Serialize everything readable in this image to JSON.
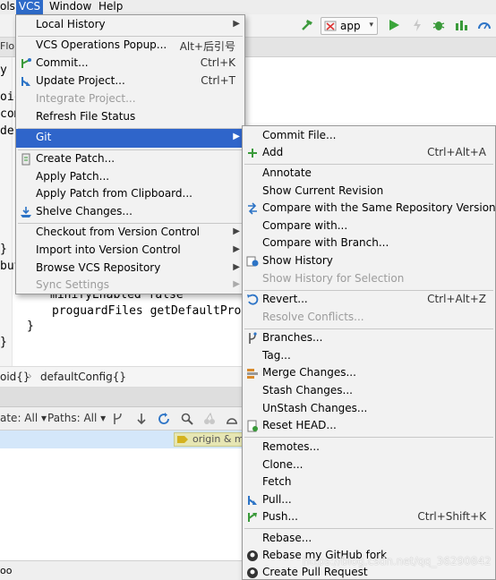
{
  "menubar": {
    "tools": "ols",
    "vcs": "VCS",
    "window": "Window",
    "help": "Help"
  },
  "toolbar": {
    "run_config": "app"
  },
  "tab_strip": {
    "visible_text": "Flo"
  },
  "editor": {
    "gutter_fragments": [
      "y",
      "oic",
      "com",
      "def",
      "}",
      "but",
      "}"
    ],
    "line_minify": "minifyEnabled false",
    "line_proguard": "proguardFiles getDefaultProg",
    "line_brace_1": "}",
    "line_brace_2": "}"
  },
  "breadcrumb": {
    "item1": "oid{}",
    "separator": "›",
    "item2": "defaultConfig{}"
  },
  "panel_toolbar": {
    "date_filter": "ate: All ▾",
    "paths_filter": "Paths: All ▾"
  },
  "log": {
    "origin_tag": "origin & m"
  },
  "statusbar": {
    "text": "oo"
  },
  "vcs_menu": {
    "items": [
      {
        "label": "Local History",
        "shortcut": "",
        "submenu": true,
        "disabled": false,
        "highlighted": false
      },
      {
        "label": "VCS Operations Popup...",
        "shortcut": "Alt+后引号",
        "submenu": false,
        "disabled": false,
        "highlighted": false
      },
      {
        "label": "Commit...",
        "shortcut": "Ctrl+K",
        "submenu": false,
        "disabled": false,
        "highlighted": false
      },
      {
        "label": "Update Project...",
        "shortcut": "Ctrl+T",
        "submenu": false,
        "disabled": false,
        "highlighted": false
      },
      {
        "label": "Integrate Project...",
        "shortcut": "",
        "submenu": false,
        "disabled": true,
        "highlighted": false
      },
      {
        "label": "Refresh File Status",
        "shortcut": "",
        "submenu": false,
        "disabled": false,
        "highlighted": false
      },
      {
        "label": "Git",
        "shortcut": "",
        "submenu": true,
        "disabled": false,
        "highlighted": true
      },
      {
        "label": "Create Patch...",
        "shortcut": "",
        "submenu": false,
        "disabled": false,
        "highlighted": false
      },
      {
        "label": "Apply Patch...",
        "shortcut": "",
        "submenu": false,
        "disabled": false,
        "highlighted": false
      },
      {
        "label": "Apply Patch from Clipboard...",
        "shortcut": "",
        "submenu": false,
        "disabled": false,
        "highlighted": false
      },
      {
        "label": "Shelve Changes...",
        "shortcut": "",
        "submenu": false,
        "disabled": false,
        "highlighted": false
      },
      {
        "label": "Checkout from Version Control",
        "shortcut": "",
        "submenu": true,
        "disabled": false,
        "highlighted": false
      },
      {
        "label": "Import into Version Control",
        "shortcut": "",
        "submenu": true,
        "disabled": false,
        "highlighted": false
      },
      {
        "label": "Browse VCS Repository",
        "shortcut": "",
        "submenu": true,
        "disabled": false,
        "highlighted": false
      },
      {
        "label": "Sync Settings",
        "shortcut": "",
        "submenu": true,
        "disabled": true,
        "highlighted": false
      }
    ]
  },
  "git_menu": {
    "items": [
      {
        "label": "Commit File...",
        "shortcut": "",
        "disabled": false
      },
      {
        "label": "Add",
        "shortcut": "Ctrl+Alt+A",
        "disabled": false
      },
      {
        "label": "Annotate",
        "shortcut": "",
        "disabled": false
      },
      {
        "label": "Show Current Revision",
        "shortcut": "",
        "disabled": false
      },
      {
        "label": "Compare with the Same Repository Version",
        "shortcut": "",
        "disabled": false
      },
      {
        "label": "Compare with...",
        "shortcut": "",
        "disabled": false
      },
      {
        "label": "Compare with Branch...",
        "shortcut": "",
        "disabled": false
      },
      {
        "label": "Show History",
        "shortcut": "",
        "disabled": false
      },
      {
        "label": "Show History for Selection",
        "shortcut": "",
        "disabled": true
      },
      {
        "label": "Revert...",
        "shortcut": "Ctrl+Alt+Z",
        "disabled": false
      },
      {
        "label": "Resolve Conflicts...",
        "shortcut": "",
        "disabled": true
      },
      {
        "label": "Branches...",
        "shortcut": "",
        "disabled": false
      },
      {
        "label": "Tag...",
        "shortcut": "",
        "disabled": false
      },
      {
        "label": "Merge Changes...",
        "shortcut": "",
        "disabled": false
      },
      {
        "label": "Stash Changes...",
        "shortcut": "",
        "disabled": false
      },
      {
        "label": "UnStash Changes...",
        "shortcut": "",
        "disabled": false
      },
      {
        "label": "Reset HEAD...",
        "shortcut": "",
        "disabled": false
      },
      {
        "label": "Remotes...",
        "shortcut": "",
        "disabled": false
      },
      {
        "label": "Clone...",
        "shortcut": "",
        "disabled": false
      },
      {
        "label": "Fetch",
        "shortcut": "",
        "disabled": false
      },
      {
        "label": "Pull...",
        "shortcut": "",
        "disabled": false
      },
      {
        "label": "Push...",
        "shortcut": "Ctrl+Shift+K",
        "disabled": false
      },
      {
        "label": "Rebase...",
        "shortcut": "",
        "disabled": false
      },
      {
        "label": "Rebase my GitHub fork",
        "shortcut": "",
        "disabled": false
      },
      {
        "label": "Create Pull Request",
        "shortcut": "",
        "disabled": false
      }
    ]
  },
  "watermark": "https://blog.csdn.net/qq_36290842",
  "colors": {
    "highlight": "#2f65ca",
    "menu_bg": "#f2f2f2",
    "disabled_text": "#9c9c9c"
  }
}
